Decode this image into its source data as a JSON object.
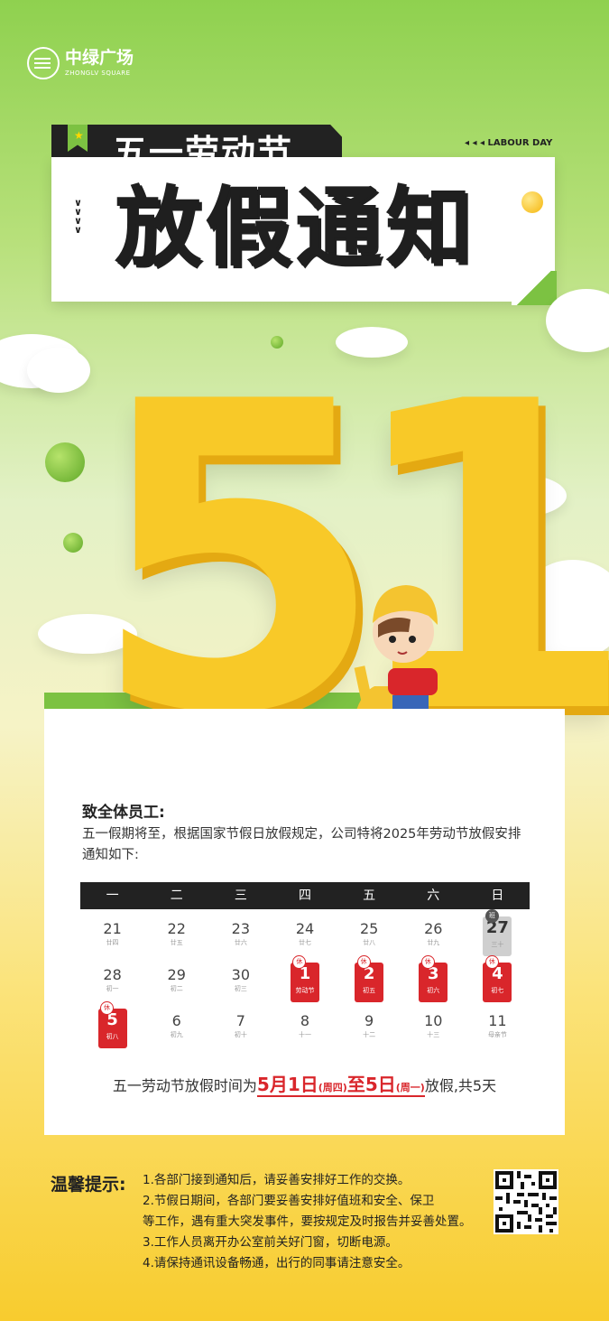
{
  "brand": {
    "name_cn": "中绿广场",
    "name_en": "ZHONGLV SQUARE"
  },
  "header": {
    "subtitle": "五一劳动节",
    "labour_day": "LABOUR DAY",
    "title": "放假通知",
    "hero": {
      "five": "5",
      "one": "1"
    }
  },
  "notice": {
    "greeting": "致全体员工:",
    "intro": "五一假期将至，根据国家节假日放假规定，公司特将2025年劳动节放假安排通知如下:",
    "weekdays": [
      "一",
      "二",
      "三",
      "四",
      "五",
      "六",
      "日"
    ],
    "rows": [
      [
        {
          "day": "21",
          "lunar": "廿四",
          "type": "normal"
        },
        {
          "day": "22",
          "lunar": "廿五",
          "type": "normal"
        },
        {
          "day": "23",
          "lunar": "廿六",
          "type": "normal"
        },
        {
          "day": "24",
          "lunar": "廿七",
          "type": "normal"
        },
        {
          "day": "25",
          "lunar": "廿八",
          "type": "normal"
        },
        {
          "day": "26",
          "lunar": "廿九",
          "type": "normal"
        },
        {
          "day": "27",
          "lunar": "三十",
          "type": "work",
          "badge": "班"
        }
      ],
      [
        {
          "day": "28",
          "lunar": "初一",
          "type": "normal"
        },
        {
          "day": "29",
          "lunar": "初二",
          "type": "normal"
        },
        {
          "day": "30",
          "lunar": "初三",
          "type": "normal"
        },
        {
          "day": "1",
          "lunar": "劳动节",
          "type": "off",
          "badge": "休"
        },
        {
          "day": "2",
          "lunar": "初五",
          "type": "off",
          "badge": "休"
        },
        {
          "day": "3",
          "lunar": "初六",
          "type": "off",
          "badge": "休"
        },
        {
          "day": "4",
          "lunar": "初七",
          "type": "off",
          "badge": "休"
        }
      ],
      [
        {
          "day": "5",
          "lunar": "初八",
          "type": "off",
          "badge": "休"
        },
        {
          "day": "6",
          "lunar": "初九",
          "type": "normal"
        },
        {
          "day": "7",
          "lunar": "初十",
          "type": "normal"
        },
        {
          "day": "8",
          "lunar": "十一",
          "type": "normal"
        },
        {
          "day": "9",
          "lunar": "十二",
          "type": "normal"
        },
        {
          "day": "10",
          "lunar": "十三",
          "type": "normal"
        },
        {
          "day": "11",
          "lunar": "母亲节",
          "type": "normal"
        }
      ]
    ],
    "summary": {
      "prefix": "五一劳动节放假时间为",
      "start": "5月1日",
      "start_week": "(周四)",
      "mid": "至",
      "end": "5日",
      "end_week": "(周一)",
      "suffix": "放假,共5天"
    }
  },
  "tips": {
    "title": "温馨提示:",
    "lines": [
      "1.各部门接到通知后，请妥善安排好工作的交换。",
      "2.节假日期间，各部门要妥善安排好值班和安全、保卫",
      "等工作，遇有重大突发事件，要按规定及时报告并妥善处置。",
      "3.工作人员离开办公室前关好门窗，切断电源。",
      "4.请保持通讯设备畅通，出行的同事请注意安全。"
    ]
  },
  "colors": {
    "green": "#7cc242",
    "yellow": "#f8c928",
    "red": "#d9262b",
    "dark": "#222222"
  }
}
